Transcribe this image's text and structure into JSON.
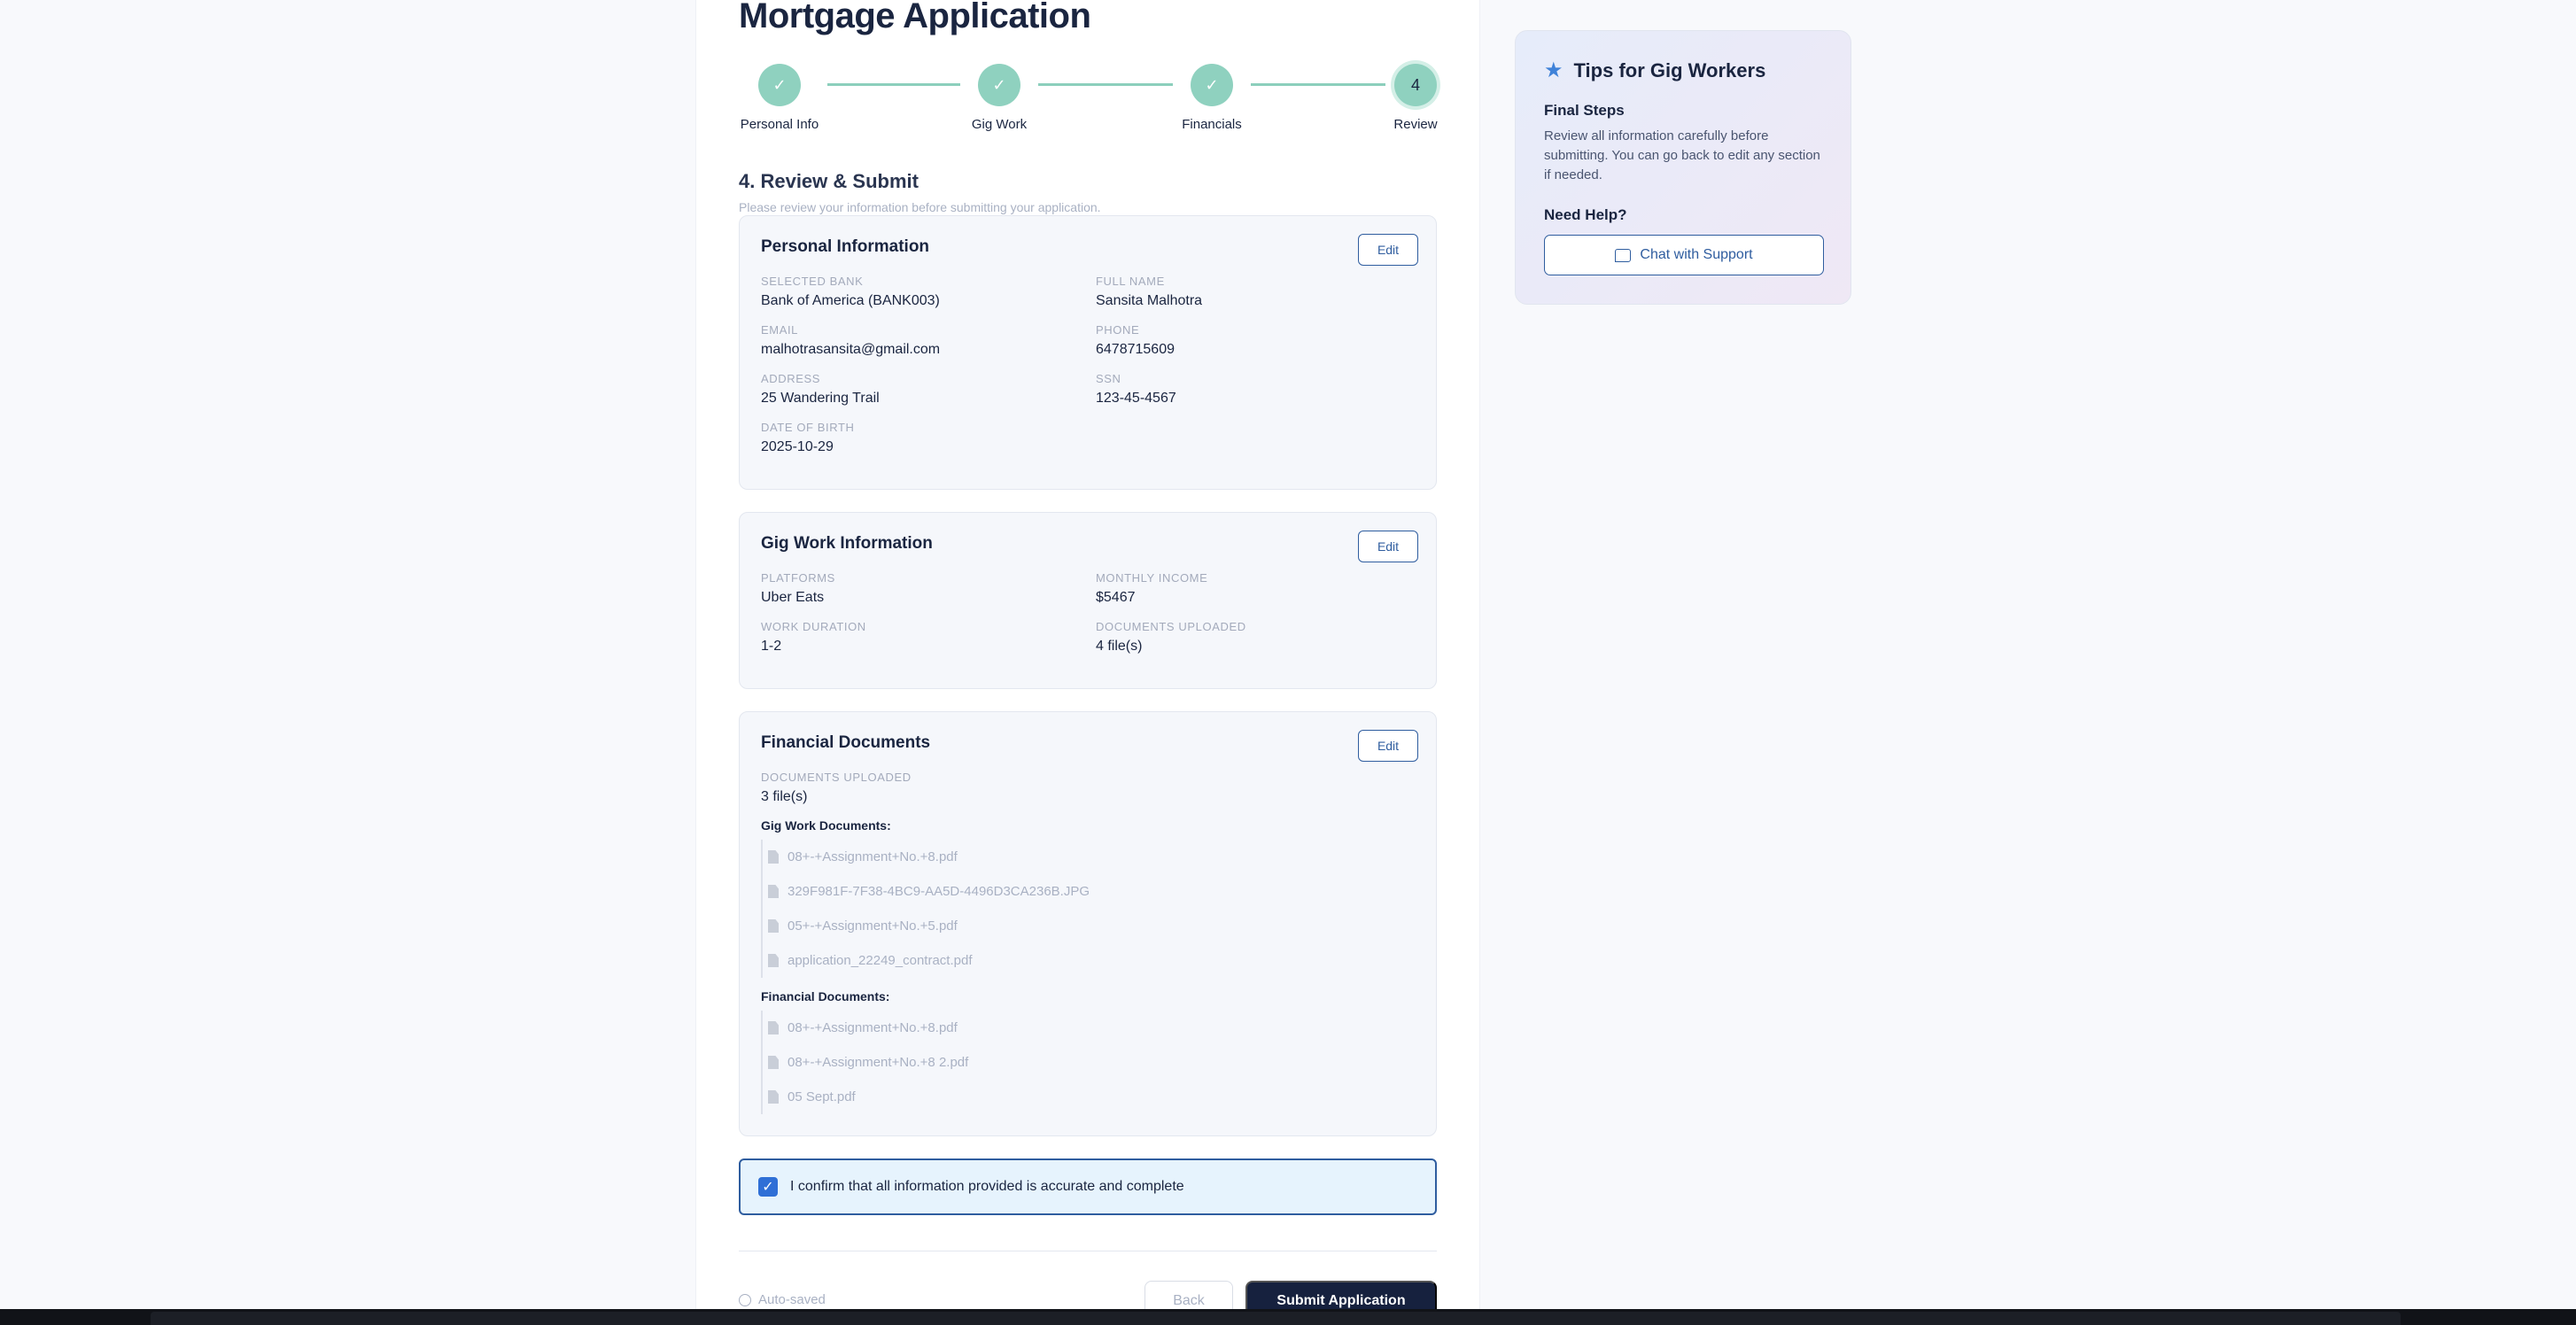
{
  "page": {
    "title": "Mortgage Application"
  },
  "stepper": {
    "steps": [
      {
        "label": "Personal Info",
        "mark": "✓"
      },
      {
        "label": "Gig Work",
        "mark": "✓"
      },
      {
        "label": "Financials",
        "mark": "✓"
      },
      {
        "label": "Review",
        "mark": "4"
      }
    ]
  },
  "review": {
    "title": "4. Review & Submit",
    "subtitle": "Please review your information before submitting your application."
  },
  "personal": {
    "title": "Personal Information",
    "edit_label": "Edit",
    "fields": [
      {
        "label": "Selected Bank",
        "value": "Bank of America (BANK003)"
      },
      {
        "label": "Full Name",
        "value": "Sansita Malhotra"
      },
      {
        "label": "Email",
        "value": "malhotrasansita@gmail.com"
      },
      {
        "label": "Phone",
        "value": "6478715609"
      },
      {
        "label": "Address",
        "value": "25 Wandering Trail"
      },
      {
        "label": "SSN",
        "value": "123-45-4567"
      },
      {
        "label": "Date of Birth",
        "value": "2025-10-29"
      }
    ]
  },
  "gig": {
    "title": "Gig Work Information",
    "edit_label": "Edit",
    "fields": [
      {
        "label": "Platforms",
        "value": "Uber Eats"
      },
      {
        "label": "Monthly Income",
        "value": "$5467"
      },
      {
        "label": "Work Duration",
        "value": "1-2"
      },
      {
        "label": "Documents Uploaded",
        "value": "4 file(s)"
      }
    ]
  },
  "financial": {
    "title": "Financial Documents",
    "edit_label": "Edit",
    "docs_label": "Documents Uploaded",
    "docs_value": "3 file(s)",
    "gig_docs_title": "Gig Work Documents:",
    "gig_docs": [
      "08+-+Assignment+No.+8.pdf",
      "329F981F-7F38-4BC9-AA5D-4496D3CA236B.JPG",
      "05+-+Assignment+No.+5.pdf",
      "application_22249_contract.pdf"
    ],
    "fin_docs_title": "Financial Documents:",
    "fin_docs": [
      "08+-+Assignment+No.+8.pdf",
      "08+-+Assignment+No.+8 2.pdf",
      "05 Sept.pdf"
    ]
  },
  "confirm": {
    "text": "I confirm that all information provided is accurate and complete",
    "checked": true
  },
  "footer": {
    "autosave": "Auto-saved",
    "back_label": "Back",
    "submit_label": "Submit Application"
  },
  "tips": {
    "title": "Tips for Gig Workers",
    "subtitle": "Final Steps",
    "body": "Review all information carefully before submitting. You can go back to edit any section if needed.",
    "help_title": "Need Help?",
    "chat_label": "Chat with Support"
  },
  "icons": {
    "tips": "star-icon",
    "chat": "chat-icon",
    "file": "file-icon",
    "autosave": "clock-icon"
  },
  "colors": {
    "accent": "#2f5d9f",
    "step": "#8fd1bf",
    "primary_button": "#16213e",
    "checkbox": "#2f6fd6"
  }
}
